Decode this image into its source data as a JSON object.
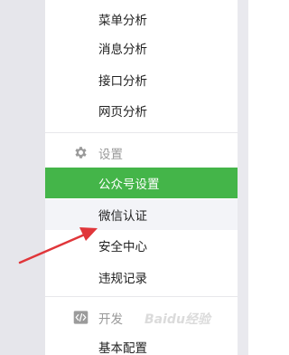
{
  "menu": {
    "analysis_items": [
      {
        "label": "菜单分析"
      },
      {
        "label": "消息分析"
      },
      {
        "label": "接口分析"
      },
      {
        "label": "网页分析"
      }
    ],
    "settings_section": {
      "title": "设置",
      "icon": "gear-icon",
      "items": [
        {
          "label": "公众号设置",
          "selected": true
        },
        {
          "label": "微信认证",
          "hovered": true
        },
        {
          "label": "安全中心"
        },
        {
          "label": "违规记录"
        }
      ]
    },
    "dev_section": {
      "title": "开发",
      "icon": "code-icon",
      "items": [
        {
          "label": "基本配置"
        }
      ]
    }
  },
  "colors": {
    "selected_bg": "#44b549",
    "hover_bg": "#f3f4f8",
    "annotation_arrow": "#e0363a"
  },
  "watermark": "Baidu经验"
}
